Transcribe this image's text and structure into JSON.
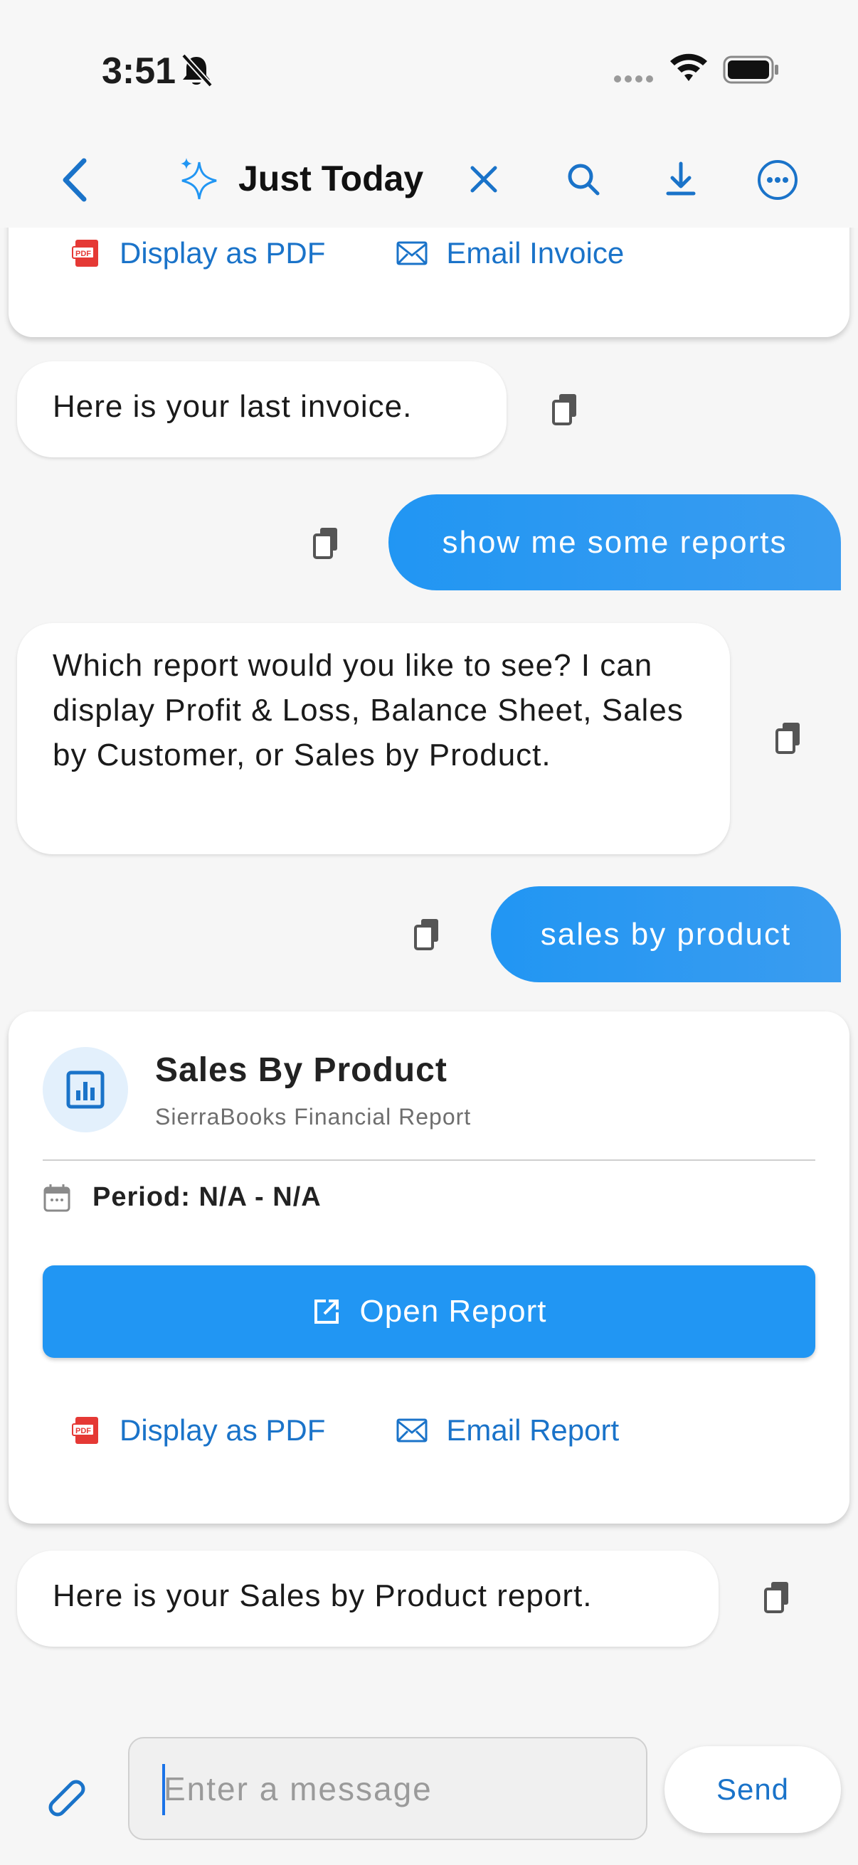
{
  "status_bar": {
    "time": "3:51"
  },
  "nav": {
    "title": "Just Today"
  },
  "invoice_card": {
    "display_pdf_label": "Display as PDF",
    "email_label": "Email Invoice"
  },
  "messages": [
    {
      "role": "bot",
      "text": "Here is your last invoice."
    },
    {
      "role": "user",
      "text": "show me some reports"
    },
    {
      "role": "bot",
      "text": "Which report would you like to see? I can display Profit & Loss, Balance Sheet, Sales by Customer, or Sales by Product."
    },
    {
      "role": "user",
      "text": "sales by product"
    },
    {
      "role": "bot",
      "text": "Here is your Sales by Product report."
    }
  ],
  "report_card": {
    "title": "Sales By Product",
    "subtitle": "SierraBooks Financial Report",
    "period": "Period: N/A - N/A",
    "open_label": "Open Report",
    "display_pdf_label": "Display as PDF",
    "email_label": "Email Report",
    "pdf_badge_text": "PDF"
  },
  "composer": {
    "placeholder": "Enter a message",
    "send_label": "Send"
  },
  "colors": {
    "accent": "#2196f3",
    "link": "#1a73c9",
    "pdf_red": "#e53935"
  }
}
